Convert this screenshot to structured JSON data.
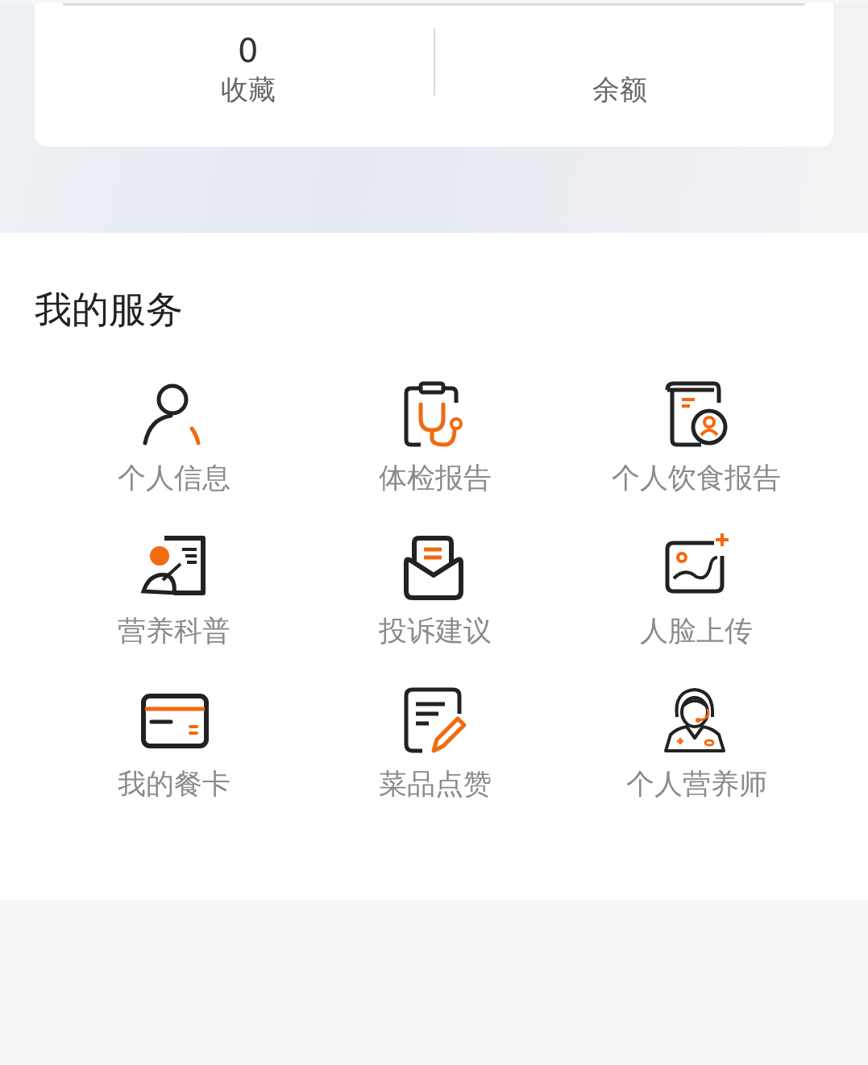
{
  "stats": [
    {
      "value": "0",
      "label": "收藏"
    },
    {
      "label": "余额"
    }
  ],
  "services": {
    "title": "我的服务",
    "items": [
      {
        "label": "个人信息"
      },
      {
        "label": "体检报告"
      },
      {
        "label": "个人饮食报告"
      },
      {
        "label": "营养科普"
      },
      {
        "label": "投诉建议"
      },
      {
        "label": "人脸上传"
      },
      {
        "label": "我的餐卡"
      },
      {
        "label": "菜品点赞"
      },
      {
        "label": "个人营养师"
      }
    ]
  }
}
